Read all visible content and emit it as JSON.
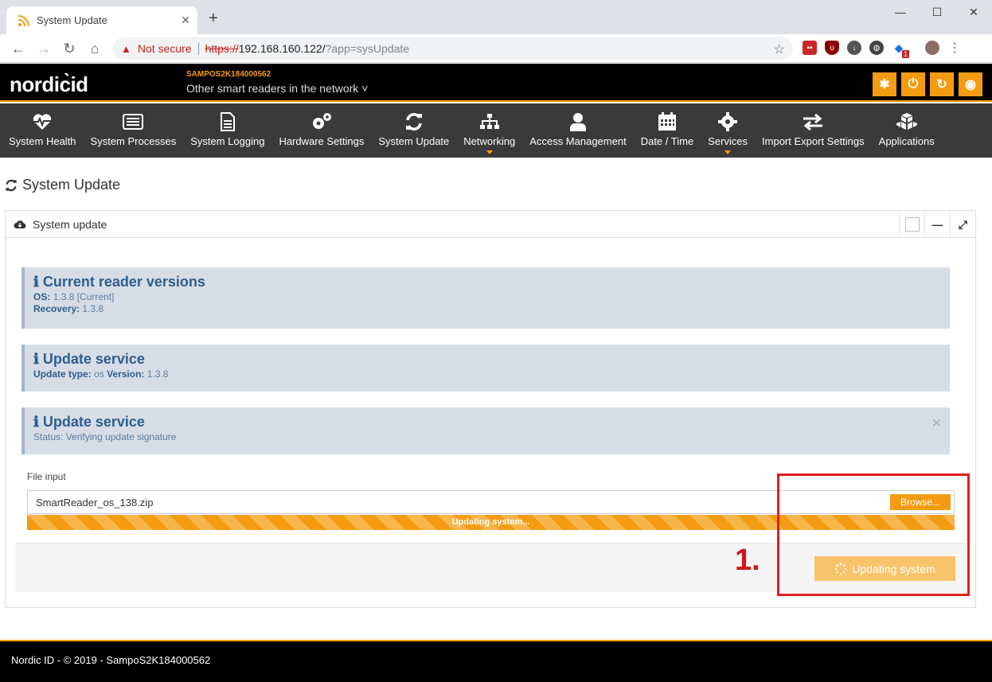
{
  "browser": {
    "tab_title": "System Update",
    "not_secure": "Not secure",
    "url_scheme": "https://",
    "url_host": "192.168.160.122/",
    "url_query": "?app=sysUpdate",
    "ext_badge": "1"
  },
  "header": {
    "logo": "nordic̀id",
    "device_name": "SAMPOS2K184000562",
    "network_label": "Other smart readers in the network ˅"
  },
  "nav": [
    {
      "label": "System Health",
      "icon": "heartbeat-icon"
    },
    {
      "label": "System Processes",
      "icon": "list-icon"
    },
    {
      "label": "System Logging",
      "icon": "document-icon"
    },
    {
      "label": "Hardware Settings",
      "icon": "gears-icon"
    },
    {
      "label": "System Update",
      "icon": "refresh-icon"
    },
    {
      "label": "Networking",
      "icon": "sitemap-icon"
    },
    {
      "label": "Access Management",
      "icon": "user-icon"
    },
    {
      "label": "Date / Time",
      "icon": "calendar-icon"
    },
    {
      "label": "Services",
      "icon": "gear-icon"
    },
    {
      "label": "Import Export Settings",
      "icon": "exchange-icon"
    },
    {
      "label": "Applications",
      "icon": "cubes-icon"
    }
  ],
  "page": {
    "title": "System Update",
    "panel_title": "System update"
  },
  "alerts": {
    "versions": {
      "title": "Current reader versions",
      "os_label": "OS:",
      "os_value": "1.3.8 [Current]",
      "recovery_label": "Recovery:",
      "recovery_value": "1.3.8"
    },
    "service1": {
      "title": "Update service",
      "type_label": "Update type:",
      "type_value": "os",
      "version_label": "Version:",
      "version_value": "1.3.8"
    },
    "service2": {
      "title": "Update service",
      "status": "Status: Verifying update signature"
    }
  },
  "file": {
    "label": "File input",
    "value": "SmartReader_os_138.zip",
    "browse": "Browse...",
    "progress_text": "Updating system..."
  },
  "update_button": "Updating system",
  "annotation": "1.",
  "footer": "Nordic ID - © 2019 - SampoS2K184000562",
  "colors": {
    "accent": "#f39c12",
    "alert_bg": "#d6dde6",
    "alert_text": "#305d8c",
    "annotation": "#e01e1e"
  }
}
